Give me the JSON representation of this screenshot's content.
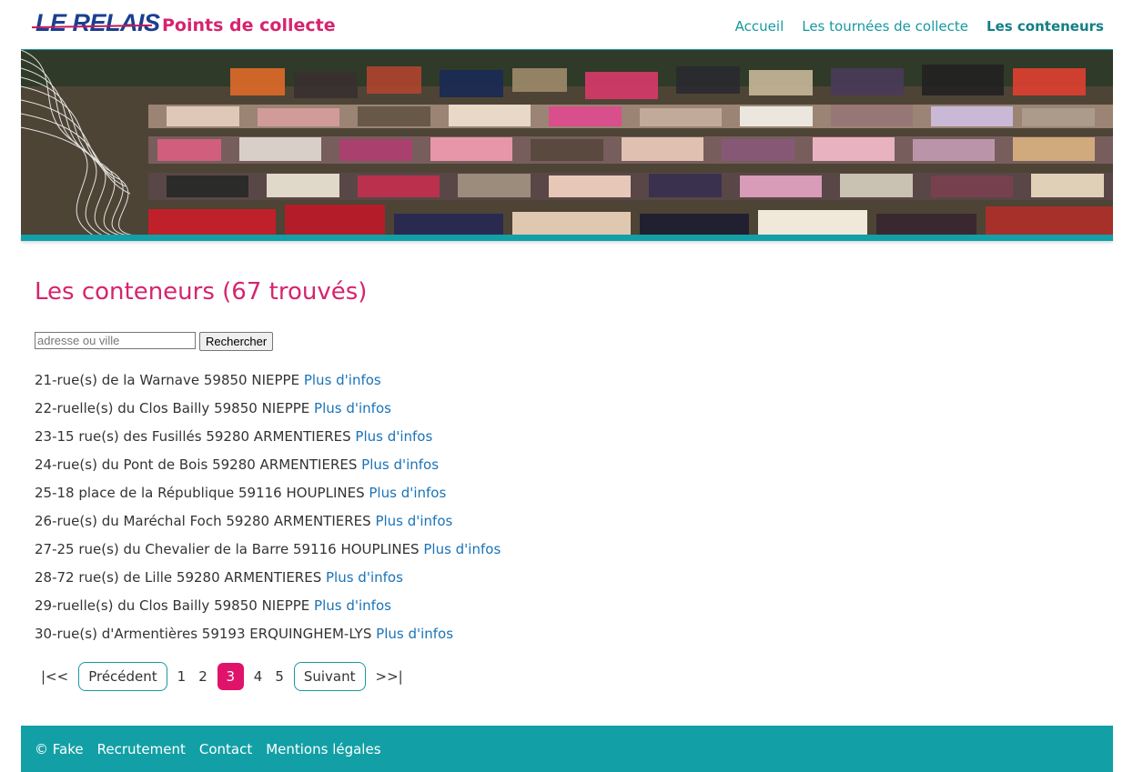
{
  "header": {
    "logo_text": "LE RELAIS",
    "site_title": "Points de collecte",
    "nav": [
      {
        "label": "Accueil"
      },
      {
        "label": "Les tournées de collecte"
      },
      {
        "label": "Les conteneurs"
      }
    ]
  },
  "main": {
    "title": "Les conteneurs (67 trouvés)",
    "search": {
      "placeholder": "adresse ou ville",
      "value": "",
      "button_label": "Rechercher"
    },
    "link_label": "Plus d'infos",
    "containers": [
      {
        "address": "21-rue(s) de la Warnave 59850 NIEPPE"
      },
      {
        "address": "22-ruelle(s) du Clos Bailly 59850 NIEPPE"
      },
      {
        "address": "23-15 rue(s) des Fusillés 59280 ARMENTIERES"
      },
      {
        "address": "24-rue(s) du Pont de Bois 59280 ARMENTIERES"
      },
      {
        "address": "25-18 place de la République 59116 HOUPLINES"
      },
      {
        "address": "26-rue(s) du Maréchal Foch 59280 ARMENTIERES"
      },
      {
        "address": "27-25 rue(s) du Chevalier de la Barre 59116 HOUPLINES"
      },
      {
        "address": "28-72 rue(s) de Lille 59280 ARMENTIERES"
      },
      {
        "address": "29-ruelle(s) du Clos Bailly 59850 NIEPPE"
      },
      {
        "address": "30-rue(s) d'Armentières 59193 ERQUINGHEM-LYS"
      }
    ],
    "pagination": {
      "first": "|<<",
      "previous": "Précédent",
      "pages": [
        "1",
        "2",
        "3",
        "4",
        "5"
      ],
      "current_page": "3",
      "next": "Suivant",
      "last": ">>|"
    }
  },
  "footer": {
    "copyright": "© Fake",
    "links": [
      {
        "label": "Recrutement"
      },
      {
        "label": "Contact"
      },
      {
        "label": "Mentions légales"
      }
    ]
  },
  "colors": {
    "brand_pink": "#d6246e",
    "teal": "#12a0a6",
    "link_blue": "#1a73b8",
    "logo_blue": "#1a3f8f"
  }
}
